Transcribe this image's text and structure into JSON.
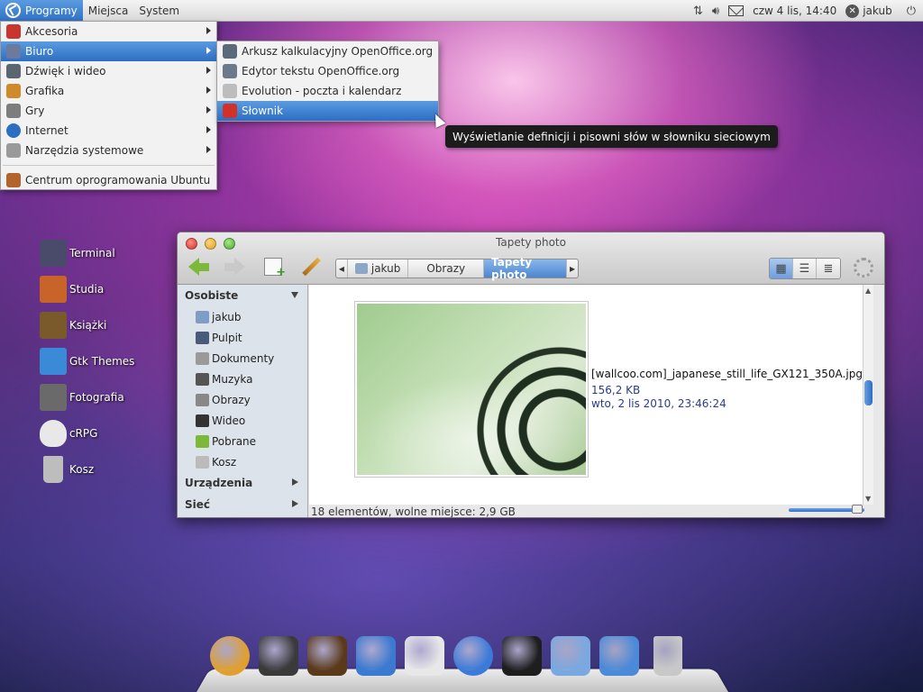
{
  "panel": {
    "menus": [
      "Programy",
      "Miejsca",
      "System"
    ],
    "clock": "czw  4 lis, 14:40",
    "user": "jakub"
  },
  "programs_menu": {
    "items": [
      {
        "label": "Akcesoria",
        "icon": "accessories-icon",
        "color": "#c9362f",
        "submenu": true
      },
      {
        "label": "Biuro",
        "icon": "office-icon",
        "color": "#6c7b9b",
        "submenu": true,
        "selected": true
      },
      {
        "label": "Dźwięk i wideo",
        "icon": "multimedia-icon",
        "color": "#5c6670",
        "submenu": true
      },
      {
        "label": "Grafika",
        "icon": "graphics-icon",
        "color": "#d08a2a",
        "submenu": true
      },
      {
        "label": "Gry",
        "icon": "games-icon",
        "color": "#7d7d7d",
        "submenu": true
      },
      {
        "label": "Internet",
        "icon": "internet-icon",
        "color": "#2a6fc2",
        "submenu": true
      },
      {
        "label": "Narzędzia systemowe",
        "icon": "system-tools-icon",
        "color": "#9a9a9a",
        "submenu": true
      }
    ],
    "footer": {
      "label": "Centrum oprogramowania Ubuntu",
      "icon": "software-center-icon",
      "color": "#b4642a"
    }
  },
  "office_submenu": {
    "items": [
      {
        "label": "Arkusz kalkulacyjny OpenOffice.org",
        "icon": "spreadsheet-icon",
        "color": "#5a6a7a"
      },
      {
        "label": "Edytor tekstu OpenOffice.org",
        "icon": "writer-icon",
        "color": "#6a7a8a"
      },
      {
        "label": "Evolution - poczta i kalendarz",
        "icon": "mail-icon",
        "color": "#bdbdbd"
      },
      {
        "label": "Słownik",
        "icon": "dictionary-icon",
        "color": "#d2312a",
        "selected": true
      }
    ]
  },
  "tooltip": "Wyświetlanie definicji i pisowni słów w słowniku sieciowym",
  "desktop_icons": [
    {
      "label": "Terminal",
      "icon": "terminal-icon",
      "color": "#4a4a6a"
    },
    {
      "label": "Studia",
      "icon": "studia-icon",
      "color": "#c8642a"
    },
    {
      "label": "Książki",
      "icon": "books-icon",
      "color": "#7a5a2a"
    },
    {
      "label": "Gtk Themes",
      "icon": "gtk-themes-icon",
      "color": "#3a8ad8"
    },
    {
      "label": "Fotografia",
      "icon": "photo-icon",
      "color": "#6a6a6a"
    },
    {
      "label": "cRPG",
      "icon": "skull-icon",
      "color": "#e8e8e8"
    },
    {
      "label": "Kosz",
      "icon": "trash-icon",
      "color": "#bdbdbd"
    }
  ],
  "window": {
    "title": "Tapety photo",
    "breadcrumbs": [
      "jakub",
      "Obrazy",
      "Tapety photo"
    ],
    "sidebar": {
      "personal_header": "Osobiste",
      "items": [
        {
          "label": "jakub",
          "icon": "home-icon"
        },
        {
          "label": "Pulpit",
          "icon": "desktop-icon"
        },
        {
          "label": "Dokumenty",
          "icon": "documents-icon"
        },
        {
          "label": "Muzyka",
          "icon": "music-icon"
        },
        {
          "label": "Obrazy",
          "icon": "pictures-icon"
        },
        {
          "label": "Wideo",
          "icon": "video-icon"
        },
        {
          "label": "Pobrane",
          "icon": "downloads-icon"
        },
        {
          "label": "Kosz",
          "icon": "trash-icon"
        }
      ],
      "devices_header": "Urządzenia",
      "network_header": "Sieć"
    },
    "file": {
      "name": "[wallcoo.com]_japanese_still_life_GX121_350A.jpg",
      "size": "156,2 KB",
      "date": "wto, 2 lis 2010, 23:46:24"
    },
    "status": "18 elementów, wolne miejsce: 2,9 GB"
  },
  "dock": [
    {
      "icon": "safari-like-icon",
      "color": "#e0a030"
    },
    {
      "icon": "camera-icon",
      "color": "#3a3a3a"
    },
    {
      "icon": "notebook-icon",
      "color": "#5a3a1a"
    },
    {
      "icon": "drawing-icon",
      "color": "#3a7ad0"
    },
    {
      "icon": "speaker-icon",
      "color": "#e8e8e8"
    },
    {
      "icon": "dashboard-icon",
      "color": "#3a7ad8"
    },
    {
      "icon": "terminal-icon",
      "color": "#1e1e1e"
    },
    {
      "icon": "folder-icon",
      "color": "#7aa8e0"
    },
    {
      "icon": "app-store-icon",
      "color": "#4a8ad8"
    },
    {
      "icon": "trash-icon",
      "color": "#c8c8c8"
    }
  ]
}
